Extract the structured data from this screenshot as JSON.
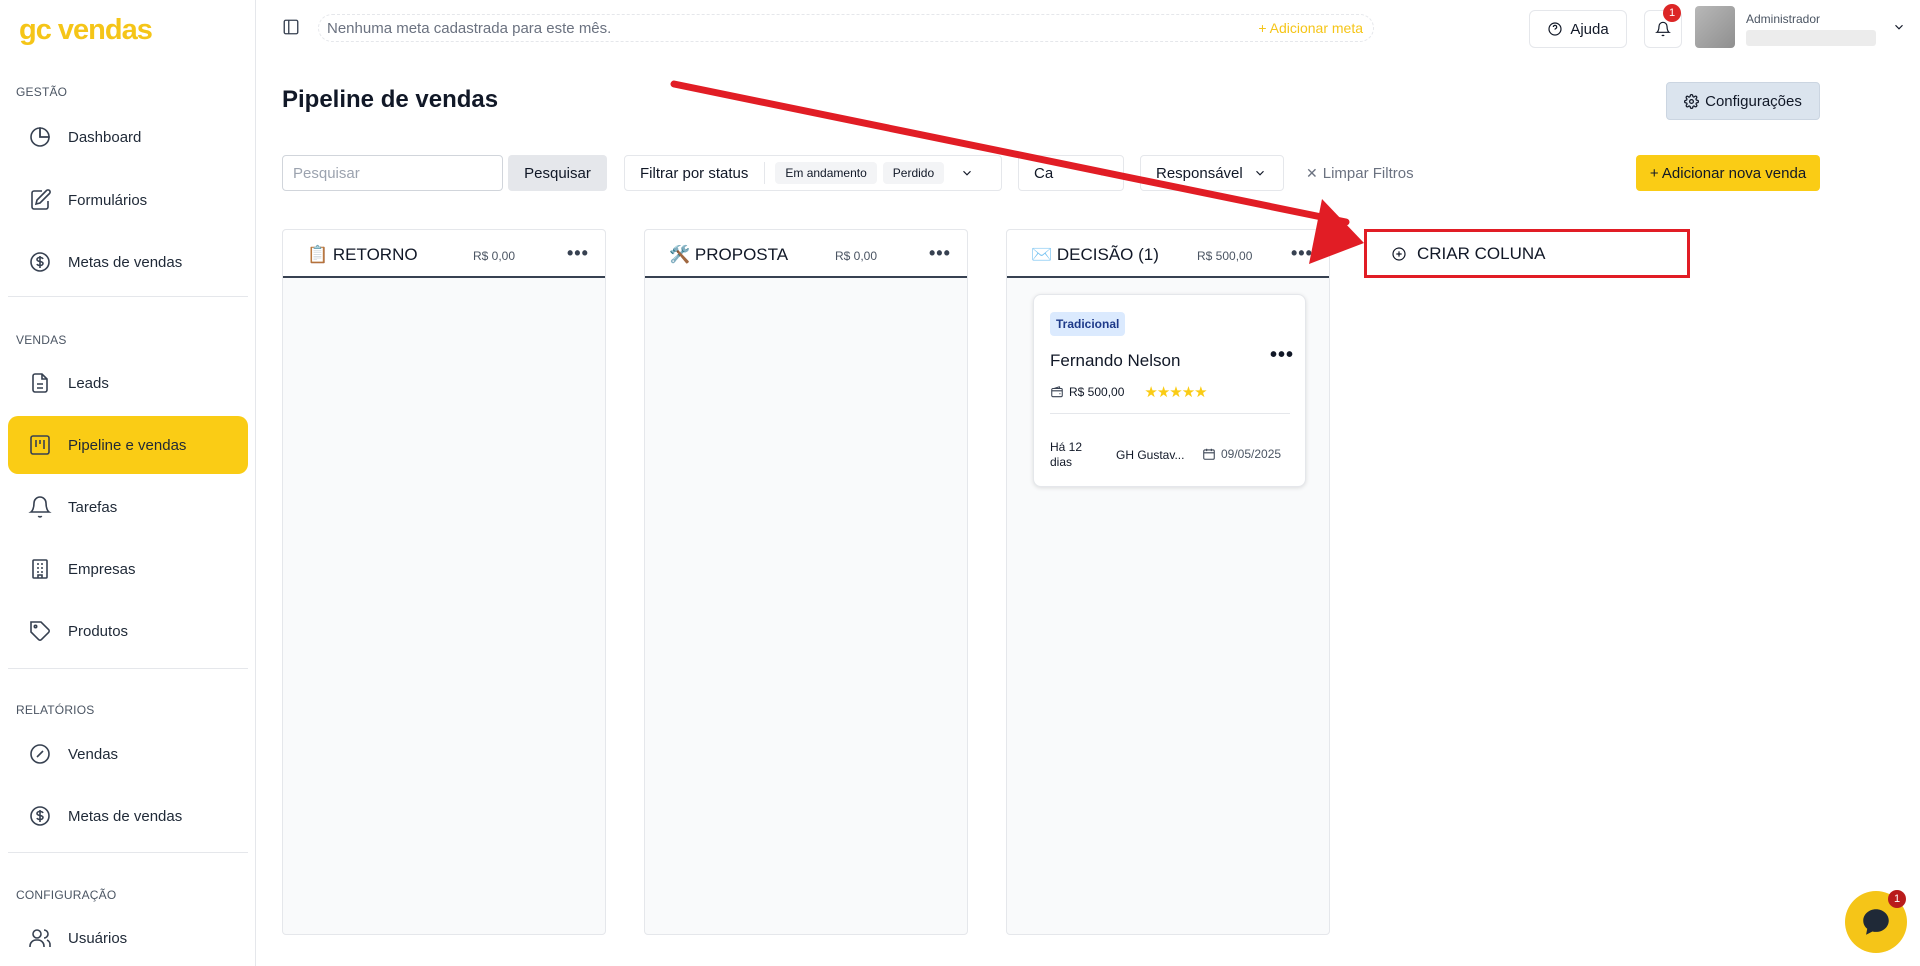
{
  "brand": {
    "logo": "gc vendas",
    "accent": "#facc15",
    "alert": "#e11d25"
  },
  "sidebar": {
    "sections": [
      {
        "title": "GESTÃO"
      },
      {
        "title": "VENDAS"
      },
      {
        "title": "RELATÓRIOS"
      },
      {
        "title": "CONFIGURAÇÃO"
      }
    ],
    "items": [
      {
        "label": "Dashboard",
        "icon": "pie-chart-icon"
      },
      {
        "label": "Formulários",
        "icon": "form-edit-icon"
      },
      {
        "label": "Metas de vendas",
        "icon": "dollar-circle-icon"
      },
      {
        "label": "Leads",
        "icon": "document-icon"
      },
      {
        "label": "Pipeline e vendas",
        "icon": "kanban-icon",
        "active": true
      },
      {
        "label": "Tarefas",
        "icon": "bell-icon"
      },
      {
        "label": "Empresas",
        "icon": "building-icon"
      },
      {
        "label": "Produtos",
        "icon": "tag-icon"
      },
      {
        "label": "Vendas",
        "icon": "gauge-icon"
      },
      {
        "label": "Metas de vendas",
        "icon": "dollar-circle-icon"
      },
      {
        "label": "Usuários",
        "icon": "users-icon"
      }
    ]
  },
  "topbar": {
    "goal_text": "Nenhuma meta cadastrada para este mês.",
    "goal_add": "+ Adicionar meta",
    "help_label": "Ajuda",
    "notification_count": "1",
    "user_role": "Administrador"
  },
  "page": {
    "title": "Pipeline de vendas",
    "config_label": "Configurações"
  },
  "filters": {
    "search_placeholder": "Pesquisar",
    "search_button": "Pesquisar",
    "status_label": "Filtrar por status",
    "status_chips": [
      "Em andamento",
      "Perdido"
    ],
    "category_label": "Ca",
    "responsible_label": "Responsável",
    "clear_label": "Limpar Filtros",
    "add_sale_label": "+ Adicionar nova venda"
  },
  "columns": [
    {
      "title": "📋 RETORNO",
      "amount": "R$ 0,00"
    },
    {
      "title": "🛠️ PROPOSTA",
      "amount": "R$ 0,00"
    },
    {
      "title": "✉️ DECISÃO (1)",
      "amount": "R$ 500,00"
    }
  ],
  "card": {
    "badge": "Tradicional",
    "name": "Fernando Nelson",
    "value": "R$ 500,00",
    "stars": "★★★★★",
    "rating": 5,
    "days": "Há 12 dias",
    "owner": "GH Gustav...",
    "date": "09/05/2025"
  },
  "create_column_label": "CRIAR COLUNA",
  "chat": {
    "badge": "1"
  }
}
